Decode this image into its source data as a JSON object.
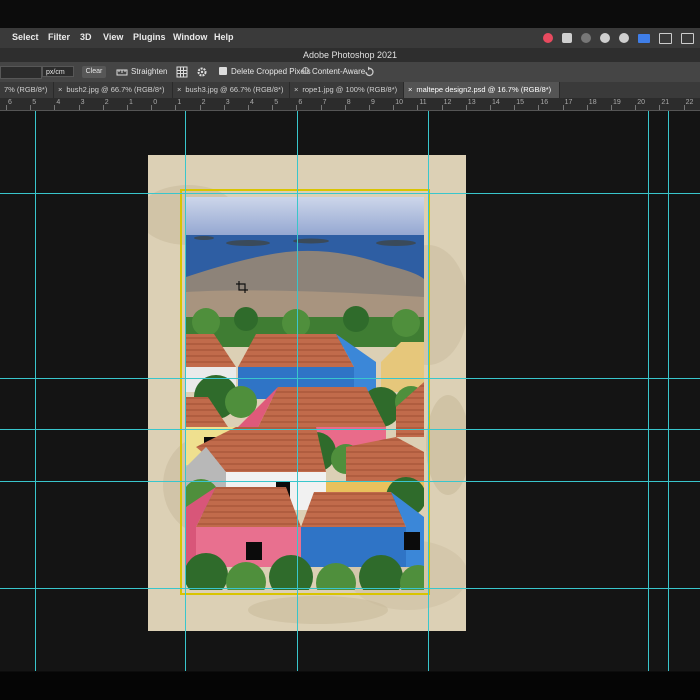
{
  "menu": {
    "items": [
      "Select",
      "Filter",
      "3D",
      "View",
      "Plugins",
      "Window",
      "Help"
    ]
  },
  "titlebar": {
    "title": "Adobe Photoshop 2021"
  },
  "options": {
    "unit": "px/cm",
    "clear_label": "Clear",
    "straighten_label": "Straighten",
    "delete_cropped_label": "Delete Cropped Pixels",
    "content_aware_label": "Content-Aware"
  },
  "tabs": [
    {
      "label": "7% (RGB/8*)",
      "active": false
    },
    {
      "label": "bush2.jpg @ 66.7% (RGB/8*)",
      "active": false
    },
    {
      "label": "bush3.jpg @ 66.7% (RGB/8*)",
      "active": false
    },
    {
      "label": "rope1.jpg @ 100% (RGB/8*)",
      "active": false
    },
    {
      "label": "maltepe design2.psd @ 16.7% (RGB/8*)",
      "active": true
    }
  ],
  "ruler": {
    "ticks": [
      "6",
      "5",
      "4",
      "3",
      "2",
      "1",
      "0",
      "1",
      "2",
      "3",
      "4",
      "5",
      "6",
      "7",
      "8",
      "9",
      "10",
      "11",
      "12",
      "13",
      "14",
      "15",
      "16",
      "17",
      "18",
      "19",
      "20",
      "21",
      "22",
      "23"
    ]
  },
  "colors": {
    "guide": "#39c6cc",
    "crop_border": "#d9c400",
    "canvas_bg": "#141414",
    "paper": "#dcd0b5"
  }
}
